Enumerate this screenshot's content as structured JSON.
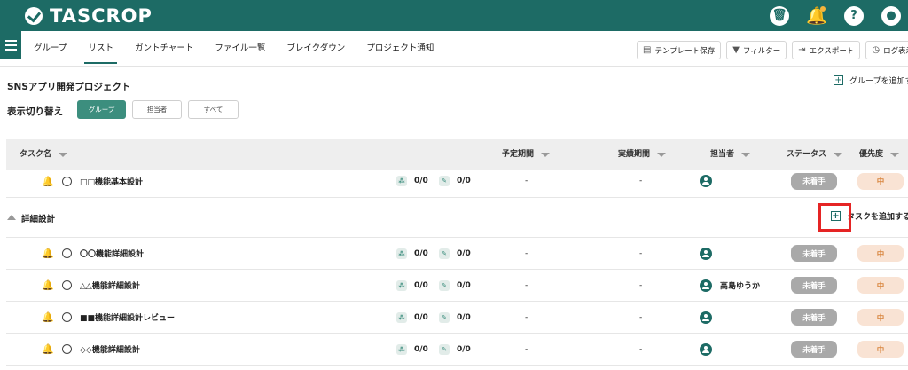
{
  "app": {
    "logo": "TASCROP"
  },
  "top_icons": [
    "trash-icon",
    "bell-icon",
    "help-icon",
    "user-icon"
  ],
  "tabs": [
    "グループ",
    "リスト",
    "ガントチャート",
    "ファイル一覧",
    "ブレイクダウン",
    "プロジェクト通知"
  ],
  "active_tab": "リスト",
  "toolbar": {
    "template_save": "テンプレート保存",
    "filter": "フィルター",
    "export": "エクスポート",
    "log": "ログ表示"
  },
  "project": {
    "title": "SNSアプリ開発プロジェクト",
    "add_group": "グループを追加す"
  },
  "view_switch": {
    "label": "表示切り替え",
    "options": [
      "グループ",
      "担当者",
      "すべて"
    ],
    "active": "グループ"
  },
  "columns": {
    "task_name": "タスク名",
    "planned": "予定期間",
    "actual": "実績期間",
    "assignee": "担当者",
    "status": "ステータス",
    "priority": "優先度"
  },
  "first_row": {
    "name": "□□機能基本設計",
    "sub": "0/0",
    "files": "0/0",
    "planned": "-",
    "actual": "-",
    "assignee": "",
    "status": "未着手",
    "priority": "中"
  },
  "group": {
    "name": "詳細設計",
    "add_task": "タスクを追加する"
  },
  "rows": [
    {
      "name": "〇〇機能詳細設計",
      "sub": "0/0",
      "files": "0/0",
      "planned": "-",
      "actual": "-",
      "assignee": "",
      "status": "未着手",
      "priority": "中"
    },
    {
      "name": "△△機能詳細設計",
      "sub": "0/0",
      "files": "0/0",
      "planned": "-",
      "actual": "-",
      "assignee": "高島ゆうか",
      "status": "未着手",
      "priority": "中"
    },
    {
      "name": "■■機能詳細設計レビュー",
      "sub": "0/0",
      "files": "0/0",
      "planned": "-",
      "actual": "-",
      "assignee": "",
      "status": "未着手",
      "priority": "中"
    },
    {
      "name": "◇◇機能詳細設計",
      "sub": "0/0",
      "files": "0/0",
      "planned": "-",
      "actual": "-",
      "assignee": "",
      "status": "未着手",
      "priority": "中"
    }
  ],
  "colors": {
    "brand": "#1d6b65",
    "active_switch": "#3c8e7e",
    "status_bg": "#a9a9a9",
    "priority_bg": "#f9e3d4",
    "highlight": "#e52424"
  }
}
